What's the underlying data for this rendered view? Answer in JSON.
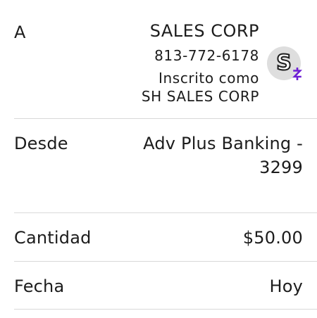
{
  "recipient": {
    "label": "A",
    "name": "SALES CORP",
    "phone": "813-772-6178",
    "enrolled_line1": "Inscrito como",
    "enrolled_line2": "SH SALES CORP",
    "avatar_letter": "S",
    "badge_icon": "zelle-icon"
  },
  "from": {
    "label": "Desde",
    "account_line1": "Adv Plus Banking -",
    "account_line2": "3299"
  },
  "amount": {
    "label": "Cantidad",
    "value": "$50.00"
  },
  "date": {
    "label": "Fecha",
    "value": "Hoy"
  },
  "colors": {
    "divider": "#d9d9d9",
    "text": "#1c1c1c",
    "avatar_bg": "#dedede",
    "badge": "#6d1ed4"
  }
}
